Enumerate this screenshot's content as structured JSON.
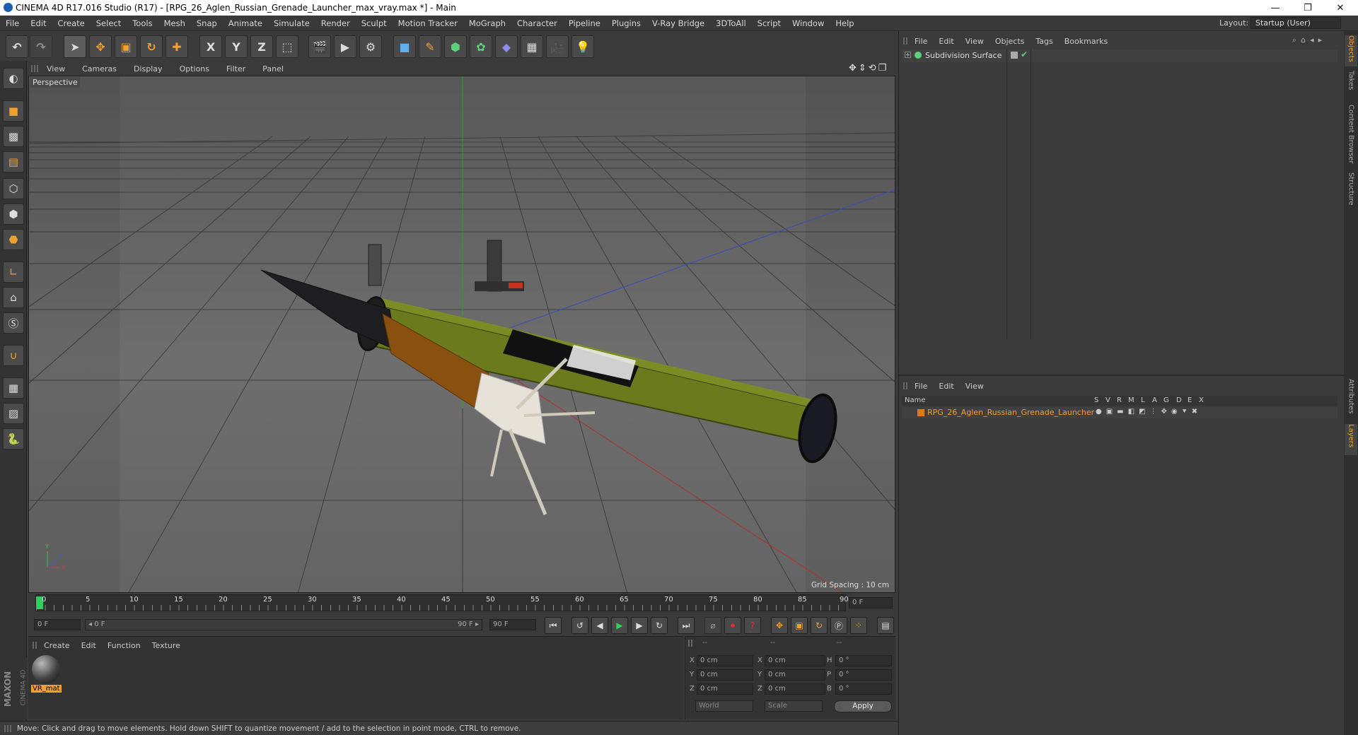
{
  "titlebar": {
    "title": "CINEMA 4D R17.016 Studio (R17) - [RPG_26_Aglen_Russian_Grenade_Launcher_max_vray.max *] - Main",
    "minimize": "—",
    "maximize": "❐",
    "close": "✕"
  },
  "menubar": {
    "items": [
      "File",
      "Edit",
      "Create",
      "Select",
      "Tools",
      "Mesh",
      "Snap",
      "Animate",
      "Simulate",
      "Render",
      "Sculpt",
      "Motion Tracker",
      "MoGraph",
      "Character",
      "Pipeline",
      "Plugins",
      "V-Ray Bridge",
      "3DToAll",
      "Script",
      "Window",
      "Help"
    ],
    "layout_label": "Layout:",
    "layout_value": "Startup (User)"
  },
  "toolbar": {
    "x_label": "X",
    "y_label": "Y",
    "z_label": "Z"
  },
  "viewport": {
    "menu": [
      "View",
      "Cameras",
      "Display",
      "Options",
      "Filter",
      "Panel"
    ],
    "label": "Perspective",
    "grid_spacing": "Grid Spacing : 10 cm"
  },
  "timeline": {
    "ticks": [
      "0",
      "5",
      "10",
      "15",
      "20",
      "25",
      "30",
      "35",
      "40",
      "45",
      "50",
      "55",
      "60",
      "65",
      "70",
      "75",
      "80",
      "85",
      "90"
    ],
    "current_frame": "0 F",
    "start_field": "0 F",
    "range_start": "◂ 0 F",
    "range_end": "90 F ▸",
    "end_field": "90 F"
  },
  "material_manager": {
    "menu": [
      "Create",
      "Edit",
      "Function",
      "Texture"
    ],
    "material_name": "VR_mat"
  },
  "coords": {
    "headers": [
      "--",
      "--",
      "--"
    ],
    "rows": [
      {
        "a": "X",
        "av": "0 cm",
        "b": "X",
        "bv": "0 cm",
        "c": "H",
        "cv": "0 °"
      },
      {
        "a": "Y",
        "av": "0 cm",
        "b": "Y",
        "bv": "0 cm",
        "c": "P",
        "cv": "0 °"
      },
      {
        "a": "Z",
        "av": "0 cm",
        "b": "Z",
        "bv": "0 cm",
        "c": "B",
        "cv": "0 °"
      }
    ],
    "world": "World",
    "scale": "Scale",
    "apply": "Apply"
  },
  "status": {
    "text": "Move: Click and drag to move elements. Hold down SHIFT to quantize movement / add to the selection in point mode, CTRL to remove."
  },
  "object_manager": {
    "menu": [
      "File",
      "Edit",
      "View",
      "Objects",
      "Tags",
      "Bookmarks"
    ],
    "object_name": "Subdivision Surface"
  },
  "layer_manager": {
    "menu": [
      "File",
      "Edit",
      "View"
    ],
    "columns": [
      "Name",
      "S",
      "V",
      "R",
      "M",
      "L",
      "A",
      "G",
      "D",
      "E",
      "X"
    ],
    "layer_name": "RPG_26_Aglen_Russian_Grenade_Launcher"
  },
  "right_tabs": [
    "Objects",
    "Takes",
    "Content Browser",
    "Structure",
    "Attributes",
    "Layers"
  ],
  "brand": {
    "maxon": "MAXON",
    "c4d": "CINEMA 4D"
  },
  "colors": {
    "accent_orange": "#f0a030",
    "layer_orange": "#e07820",
    "launcher_green": "#6b7a1c"
  }
}
